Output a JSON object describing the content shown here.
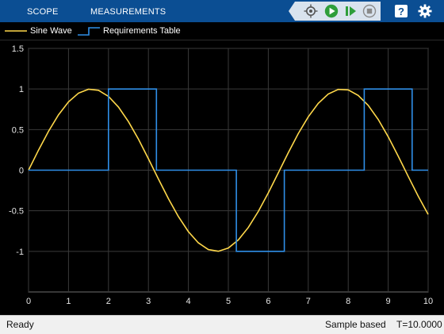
{
  "toolstrip": {
    "tabs": [
      {
        "label": "SCOPE"
      },
      {
        "label": "MEASUREMENTS"
      }
    ],
    "buttons": [
      {
        "name": "highlight-block",
        "icon": "highlight-icon"
      },
      {
        "name": "run",
        "icon": "run-icon"
      },
      {
        "name": "step-forward",
        "icon": "step-forward-icon"
      },
      {
        "name": "stop",
        "icon": "stop-icon"
      },
      {
        "name": "help",
        "icon": "help-icon"
      },
      {
        "name": "settings",
        "icon": "gear-icon"
      }
    ],
    "colors": {
      "bar": "#0b4e93",
      "group": "#d9e3ee",
      "run": "#2e9e3a"
    }
  },
  "legend": {
    "entries": [
      {
        "label": "Sine Wave",
        "color": "#ffd84a"
      },
      {
        "label": "Requirements Table",
        "color": "#2f8fe8"
      }
    ],
    "placement": "top"
  },
  "status": {
    "left": "Ready",
    "mode": "Sample based",
    "time": "T=10.0000"
  },
  "chart_data": {
    "type": "line",
    "title": "",
    "xlabel": "",
    "ylabel": "",
    "xlim": [
      0,
      10
    ],
    "ylim": [
      -1.5,
      1.5
    ],
    "grid": true,
    "background": "#000000",
    "x_ticks": [
      "0",
      "1",
      "2",
      "3",
      "4",
      "5",
      "6",
      "7",
      "8",
      "9",
      "10"
    ],
    "y_ticks": [
      "1.5",
      "1",
      "0.5",
      "0",
      "-0.5",
      "-1"
    ],
    "x_tick_values": [
      0,
      1,
      2,
      3,
      4,
      5,
      6,
      7,
      8,
      9,
      10
    ],
    "y_tick_values": [
      1.5,
      1,
      0.5,
      0,
      -0.5,
      -1
    ],
    "series": [
      {
        "name": "Sine Wave",
        "style": "line",
        "color": "#ffd84a",
        "x": [
          0,
          0.25,
          0.5,
          0.75,
          1,
          1.25,
          1.5,
          1.75,
          2,
          2.25,
          2.5,
          2.75,
          3,
          3.25,
          3.5,
          3.75,
          4,
          4.25,
          4.5,
          4.75,
          5,
          5.25,
          5.5,
          5.75,
          6,
          6.25,
          6.5,
          6.75,
          7,
          7.25,
          7.5,
          7.75,
          8,
          8.25,
          8.5,
          8.75,
          9,
          9.25,
          9.5,
          9.75,
          10
        ],
        "values": [
          0,
          0.247,
          0.479,
          0.682,
          0.841,
          0.949,
          0.997,
          0.984,
          0.909,
          0.778,
          0.598,
          0.382,
          0.141,
          -0.108,
          -0.351,
          -0.572,
          -0.757,
          -0.895,
          -0.978,
          -0.999,
          -0.959,
          -0.859,
          -0.706,
          -0.508,
          -0.279,
          -0.033,
          0.215,
          0.45,
          0.657,
          0.823,
          0.938,
          0.995,
          0.989,
          0.921,
          0.798,
          0.625,
          0.412,
          0.174,
          -0.075,
          -0.319,
          -0.544
        ]
      },
      {
        "name": "Requirements Table",
        "style": "step",
        "color": "#2f8fe8",
        "x": [
          0,
          2,
          2,
          3.2,
          3.2,
          5.2,
          5.2,
          6.4,
          6.4,
          8.4,
          8.4,
          9.6,
          9.6,
          10
        ],
        "values": [
          0,
          0,
          1,
          1,
          0,
          0,
          -1,
          -1,
          0,
          0,
          1,
          1,
          0,
          0
        ]
      }
    ]
  }
}
